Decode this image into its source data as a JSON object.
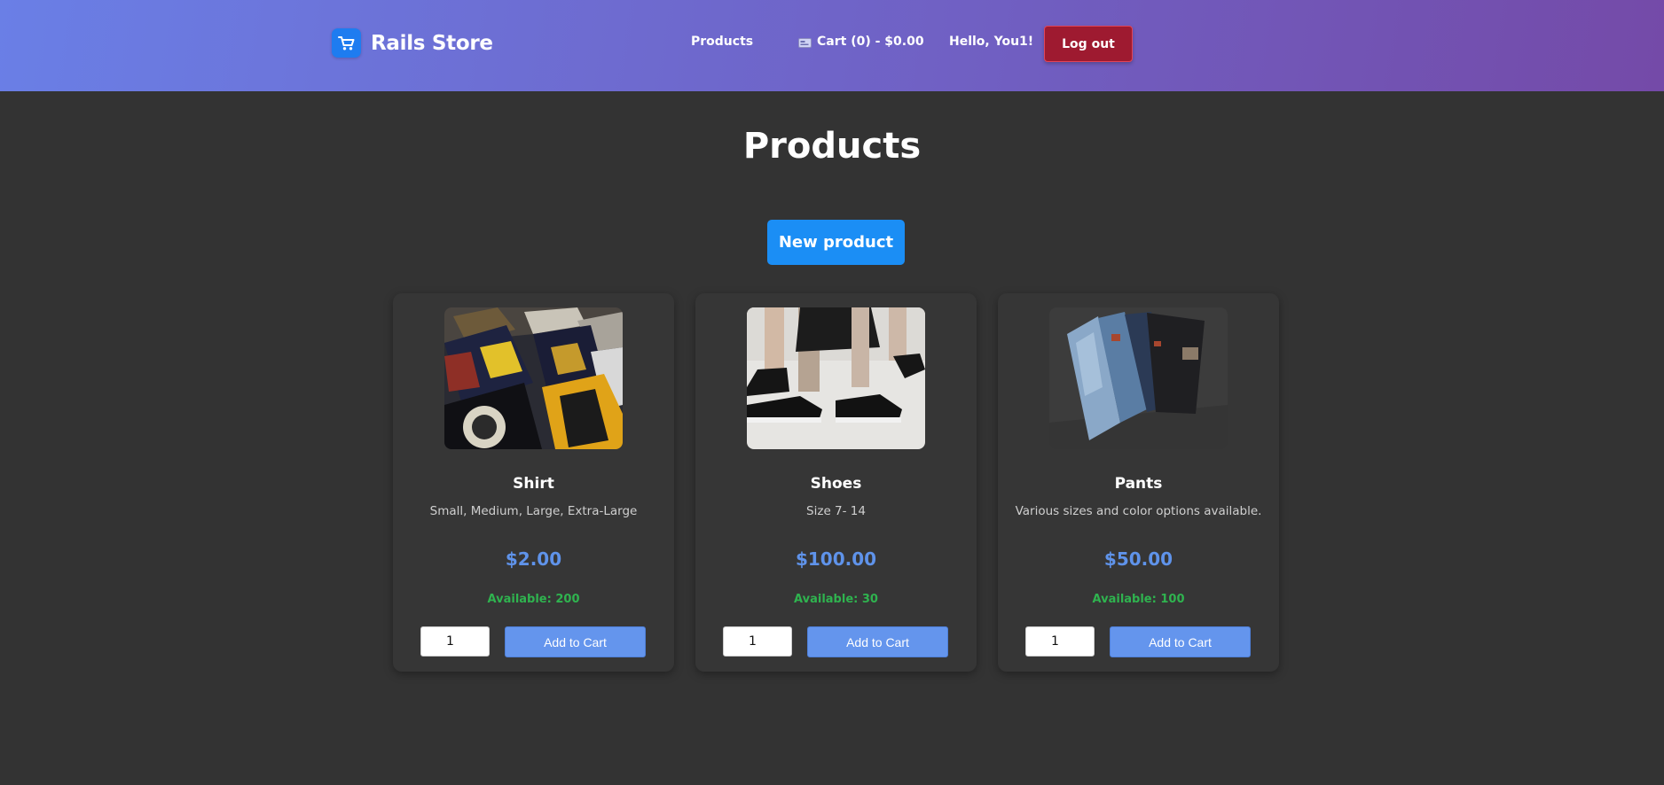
{
  "header": {
    "brand_name": "Rails Store",
    "brand_icon": "shopping-cart-icon",
    "nav_products": "Products",
    "cart_link": "Cart (0) - $0.00",
    "greeting": "Hello, You1!",
    "logout_label": "Log out"
  },
  "main": {
    "title": "Products",
    "new_product_label": "New product",
    "products": [
      {
        "name": "Shirt",
        "description": "Small, Medium, Large, Extra-Large",
        "price": "$2.00",
        "availability": "Available: 200",
        "quantity": "1",
        "add_label": "Add to Cart"
      },
      {
        "name": "Shoes",
        "description": "Size 7- 14",
        "price": "$100.00",
        "availability": "Available: 30",
        "quantity": "1",
        "add_label": "Add to Cart"
      },
      {
        "name": "Pants",
        "description": "Various sizes and color options available.",
        "price": "$50.00",
        "availability": "Available: 100",
        "quantity": "1",
        "add_label": "Add to Cart"
      }
    ]
  },
  "colors": {
    "header_gradient_start": "#6a7fe6",
    "header_gradient_end": "#744aa8",
    "background": "#333333",
    "card": "#363636",
    "price": "#5f93ea",
    "availability": "#2fb34f",
    "logout": "#9e1a30",
    "new_product": "#1b8ef5",
    "add_to_cart": "#6495ed"
  }
}
